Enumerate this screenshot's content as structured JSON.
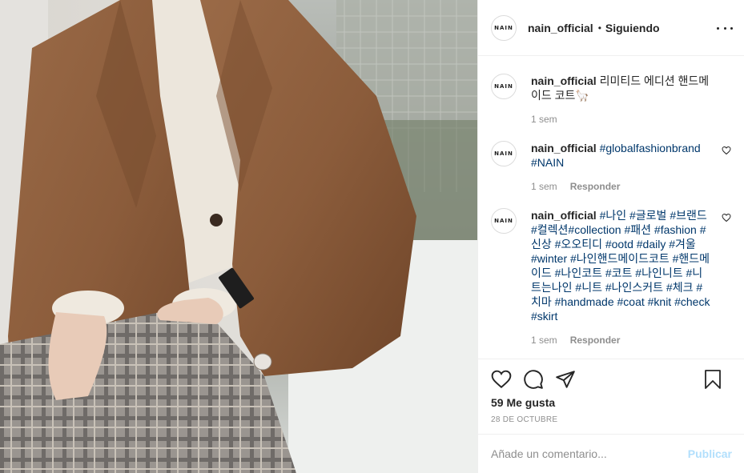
{
  "post": {
    "photo_icon": "fashion-photo-brown-coat",
    "username": "nain_official",
    "separator": "•",
    "follow_status": "Siguiendo",
    "avatar_text": "NAIN",
    "more_icon": "more-options-icon"
  },
  "comments": [
    {
      "username": "nain_official",
      "text": "리미티드 에디션 핸드메이드 코트🦙",
      "time": "1 sem",
      "reply": ""
    },
    {
      "username": "nain_official",
      "text": "#globalfashionbrand #NAIN",
      "time": "1 sem",
      "reply": "Responder"
    },
    {
      "username": "nain_official",
      "text": "#나인 #글로벌 #브랜드#컬렉션#collection #패션 #fashion #신상 #오오티디 #ootd #daily #겨울 #winter #나인핸드메이드코트 #핸드메이드 #나인코트 #코트 #나인니트 #니트는나인 #니트 #나인스커트 #체크 #치마 #handmade #coat #knit #check #skirt",
      "time": "1 sem",
      "reply": "Responder"
    }
  ],
  "actions": {
    "like_icon": "heart-icon",
    "comment_icon": "comment-icon",
    "share_icon": "share-icon",
    "save_icon": "bookmark-icon",
    "likes": "59 Me gusta",
    "date": "28 DE OCTUBRE"
  },
  "composer": {
    "placeholder": "Añade un comentario...",
    "publish": "Publicar"
  },
  "colors": {
    "link": "#00376b",
    "muted": "#8e8e8e",
    "publish_disabled": "#b2dffc"
  }
}
